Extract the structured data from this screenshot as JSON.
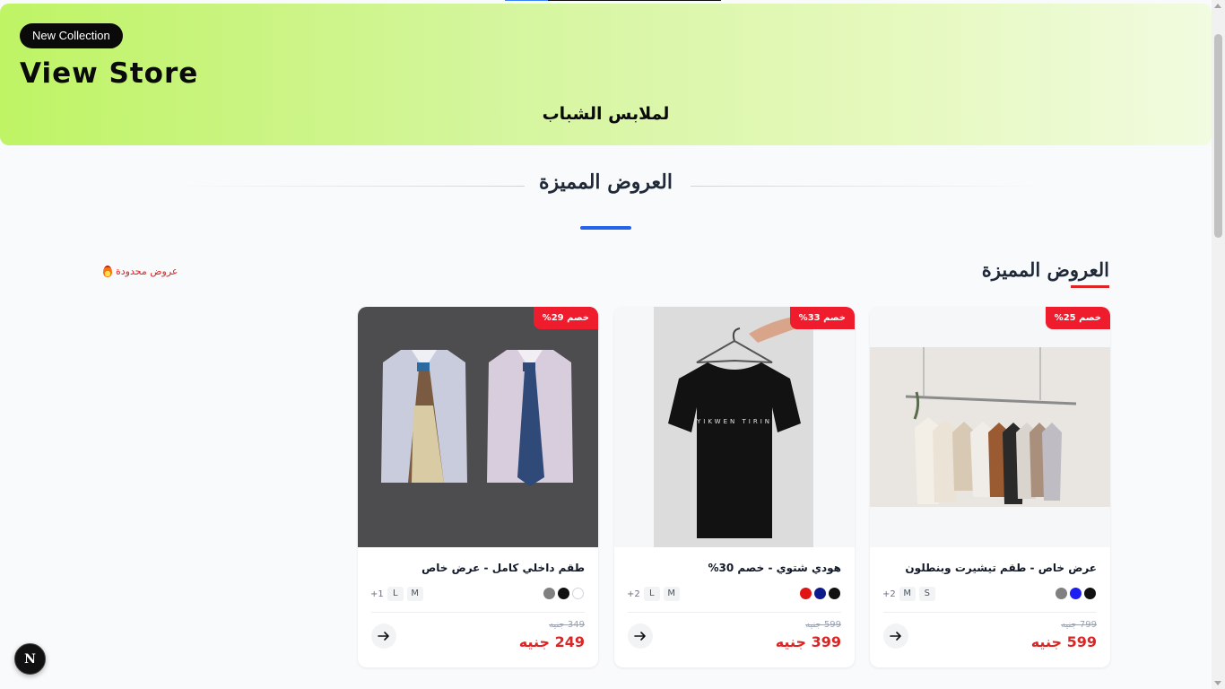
{
  "hero": {
    "badge": "New Collection",
    "title": "View Store",
    "subtitle": "لملابس الشباب",
    "gradient_colors": [
      "#bff465",
      "#f1fbe0"
    ]
  },
  "featured": {
    "section_title": "العروض المميزة",
    "sub_heading": "العروض المميزة",
    "limited_label": "عروض محدودة",
    "accent_color": "#2563eb",
    "sale_color": "#dc2626"
  },
  "products": [
    {
      "discount": "خصم 25%",
      "name": "عرض خاص - طقم تيشيرت وبنطلون",
      "sizes": [
        "S",
        "M"
      ],
      "more_sizes": "+2",
      "colors": [
        "#111111",
        "#1d1ff0",
        "#808080"
      ],
      "old_price": "799 جنيه",
      "new_price": "599 جنيه",
      "image": "clothes-rack"
    },
    {
      "discount": "خصم 33%",
      "name": "هودي شتوي - خصم 30%",
      "sizes": [
        "M",
        "L"
      ],
      "more_sizes": "+2",
      "colors": [
        "#111111",
        "#0c1a8c",
        "#e01414"
      ],
      "old_price": "599 جنيه",
      "new_price": "399 جنيه",
      "image": "black-tshirt",
      "tshirt_print": "YIKWEN TIRIN"
    },
    {
      "discount": "خصم 29%",
      "name": "طقم داخلي كامل - عرض خاص",
      "sizes": [
        "M",
        "L"
      ],
      "more_sizes": "+1",
      "colors": [
        "#ffffff",
        "#111111",
        "#808080"
      ],
      "old_price": "349 جنيه",
      "new_price": "249 جنيه",
      "image": "dress-shirts"
    }
  ],
  "dev_badge": "N"
}
